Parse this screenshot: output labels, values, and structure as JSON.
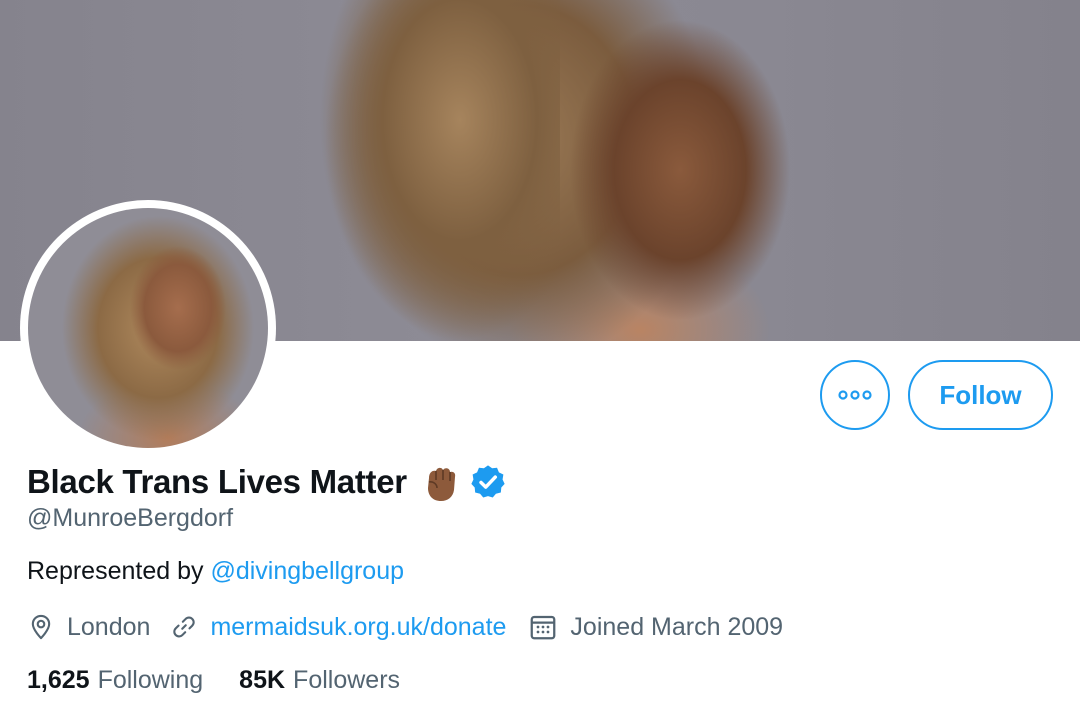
{
  "profile": {
    "display_name": "Black Trans Lives Matter",
    "name_emoji": "raised-fist-medium-dark-skin",
    "verified": true,
    "handle": "@MunroeBergdorf",
    "bio_prefix": "Represented by ",
    "bio_mention": "@divingbellgroup",
    "location": "London",
    "website": "mermaidsuk.org.uk/donate",
    "joined": "Joined March 2009"
  },
  "stats": {
    "following_count": "1,625",
    "following_label": "Following",
    "followers_count": "85K",
    "followers_label": "Followers"
  },
  "actions": {
    "follow_label": "Follow",
    "more_icon": "more-horizontal-icon"
  },
  "icons": {
    "location": "location-pin-icon",
    "link": "link-icon",
    "calendar": "calendar-icon",
    "verified": "verified-badge-icon"
  },
  "colors": {
    "accent": "#1d9bf0",
    "text_primary": "#0f1419",
    "text_secondary": "#536471"
  }
}
